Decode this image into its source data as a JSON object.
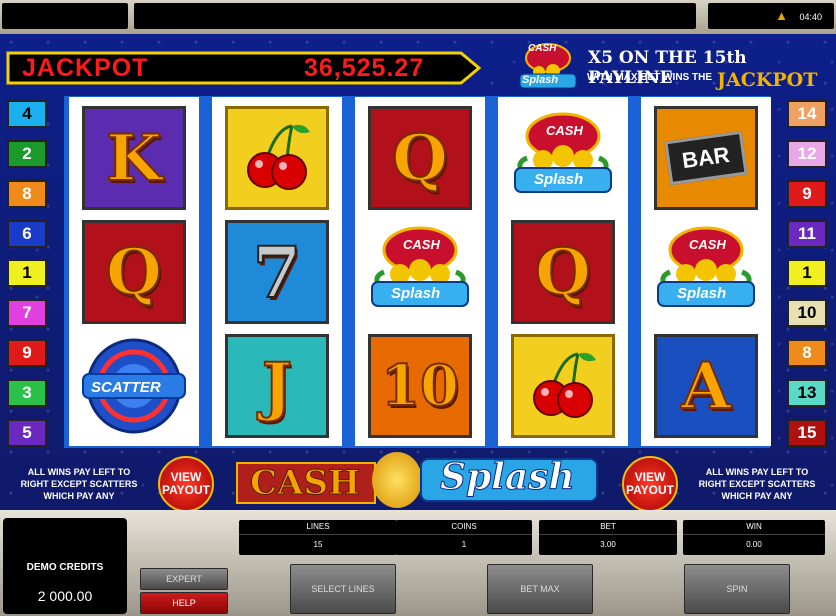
{
  "status_bar": {
    "clock": "04:40"
  },
  "jackpot": {
    "label": "JACKPOT",
    "value": "36,525.27"
  },
  "promo": {
    "line1": "X5 ON THE 15th PAYLINE",
    "line2": "WITH MAX BET WINS THE",
    "line3": "JACKPOT"
  },
  "logo": {
    "word1": "CASH",
    "word2": "Splash"
  },
  "paylines_left": [
    "4",
    "2",
    "8",
    "6",
    "1",
    "7",
    "9",
    "3",
    "5"
  ],
  "paylines_right": [
    "14",
    "12",
    "9",
    "11",
    "1",
    "10",
    "8",
    "13",
    "15"
  ],
  "reels": [
    [
      "K",
      "Q",
      "SCATTER"
    ],
    [
      "cherries",
      "7",
      "J"
    ],
    [
      "Q",
      "cash-splash",
      "10"
    ],
    [
      "cash-splash",
      "Q",
      "cherries"
    ],
    [
      "BAR",
      "cash-splash",
      "A"
    ]
  ],
  "symbols": {
    "bar_label": "BAR",
    "scatter_label": "SCATTER",
    "seven_label": "7"
  },
  "info_left": [
    "ALL WINS PAY LEFT TO",
    "RIGHT EXCEPT SCATTERS",
    "WHICH PAY ANY"
  ],
  "info_right": [
    "ALL WINS PAY LEFT TO",
    "RIGHT EXCEPT SCATTERS",
    "WHICH PAY ANY"
  ],
  "view_payout": {
    "line1": "VIEW",
    "line2": "PAYOUT"
  },
  "credits": {
    "label": "DEMO CREDITS",
    "value": "2 000.00"
  },
  "meters": {
    "lines": {
      "label": "LINES",
      "value": "15"
    },
    "coins": {
      "label": "COINS",
      "value": "1"
    },
    "bet": {
      "label": "BET",
      "value": "3.00"
    },
    "win": {
      "label": "WIN",
      "value": "0.00"
    }
  },
  "buttons": {
    "expert": "EXPERT",
    "help": "HELP",
    "select_lines": "SELECT LINES",
    "bet_max": "BET MAX",
    "spin": "SPIN"
  },
  "colors": {
    "background": "#0d1f8a",
    "jackpot_text": "#ff1a1a",
    "gold": "#f3b400",
    "help_red": "#b01010"
  }
}
